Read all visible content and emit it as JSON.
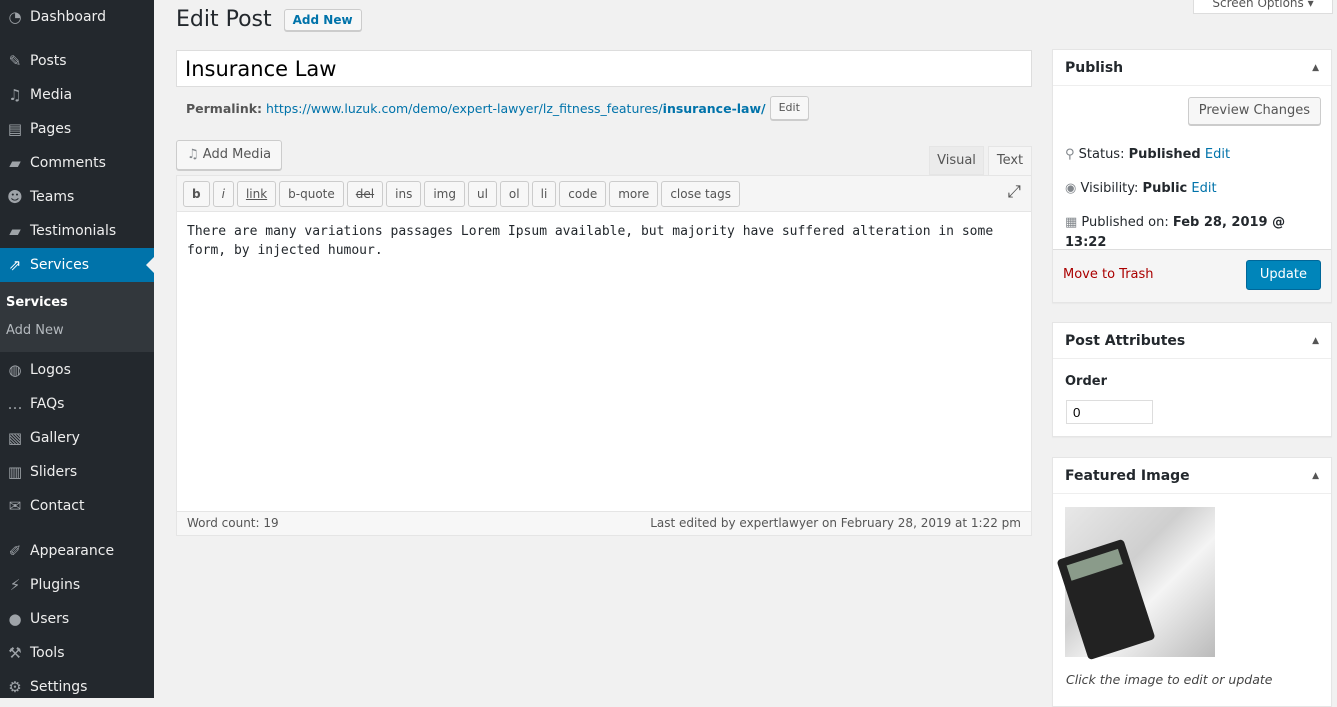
{
  "sidebar": {
    "items": [
      {
        "label": "Dashboard",
        "icon": "dashboard-icon",
        "glyph": "◔"
      },
      {
        "label": "Posts",
        "icon": "pin-icon",
        "glyph": "✎"
      },
      {
        "label": "Media",
        "icon": "media-icon",
        "glyph": "♫"
      },
      {
        "label": "Pages",
        "icon": "pages-icon",
        "glyph": "▤"
      },
      {
        "label": "Comments",
        "icon": "comment-icon",
        "glyph": "▰"
      },
      {
        "label": "Teams",
        "icon": "groups-icon",
        "glyph": "☻"
      },
      {
        "label": "Testimonials",
        "icon": "testimonial-icon",
        "glyph": "▰"
      },
      {
        "label": "Services",
        "icon": "share-icon",
        "glyph": "⇗"
      },
      {
        "label": "Logos",
        "icon": "globe-icon",
        "glyph": "◍"
      },
      {
        "label": "FAQs",
        "icon": "chat-icon",
        "glyph": "…"
      },
      {
        "label": "Gallery",
        "icon": "gallery-icon",
        "glyph": "▧"
      },
      {
        "label": "Sliders",
        "icon": "slides-icon",
        "glyph": "▥"
      },
      {
        "label": "Contact",
        "icon": "email-icon",
        "glyph": "✉"
      },
      {
        "label": "Appearance",
        "icon": "brush-icon",
        "glyph": "✐"
      },
      {
        "label": "Plugins",
        "icon": "plugin-icon",
        "glyph": "⚡"
      },
      {
        "label": "Users",
        "icon": "user-icon",
        "glyph": "●"
      },
      {
        "label": "Tools",
        "icon": "wrench-icon",
        "glyph": "⚒"
      },
      {
        "label": "Settings",
        "icon": "settings-icon",
        "glyph": "⚙"
      }
    ],
    "submenu": [
      "Services",
      "Add New"
    ]
  },
  "header": {
    "title": "Edit Post",
    "add_new": "Add New",
    "screen_options": "Screen Options ▾"
  },
  "post": {
    "title": "Insurance Law",
    "permalink_label": "Permalink:",
    "permalink_base": "https://www.luzuk.com/demo/expert-lawyer/lz_fitness_features/",
    "permalink_slug": "insurance-law/",
    "permalink_edit": "Edit"
  },
  "editor": {
    "add_media": "Add Media",
    "tabs": [
      "Visual",
      "Text"
    ],
    "quicktags": [
      "b",
      "i",
      "link",
      "b-quote",
      "del",
      "ins",
      "img",
      "ul",
      "ol",
      "li",
      "code",
      "more",
      "close tags"
    ],
    "content": "There are many variations passages Lorem Ipsum available, but majority have suffered alteration in some form, by injected humour.",
    "word_count": "Word count: 19",
    "last_edited": "Last edited by expertlawyer on February 28, 2019 at 1:22 pm"
  },
  "publish": {
    "title": "Publish",
    "preview": "Preview Changes",
    "status_label": "Status:",
    "status": "Published",
    "visibility_label": "Visibility:",
    "visibility": "Public",
    "published_label": "Published on:",
    "published": "Feb 28, 2019 @ 13:22",
    "edit": "Edit",
    "trash": "Move to Trash",
    "update": "Update"
  },
  "attributes": {
    "title": "Post Attributes",
    "order_label": "Order",
    "order": "0"
  },
  "featured": {
    "title": "Featured Image",
    "caption": "Click the image to edit or update"
  }
}
